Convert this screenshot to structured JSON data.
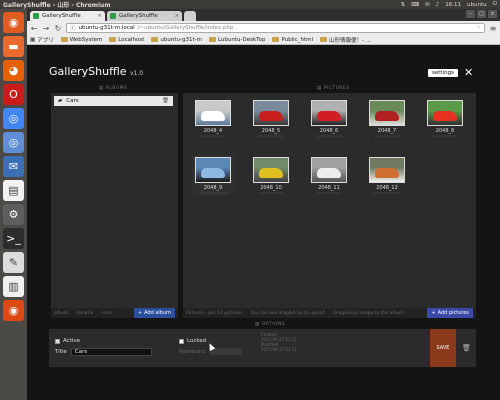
{
  "system": {
    "window_title": "GalleryShuffle - 山形 - Chromium",
    "clock": "16:11",
    "user": "ubuntu"
  },
  "launcher": [
    {
      "name": "dash-icon",
      "glyph": "◉",
      "color": "#e15b20"
    },
    {
      "name": "files-icon",
      "glyph": "▬",
      "color": "#e96a2c"
    },
    {
      "name": "firefox-icon",
      "glyph": "◕",
      "color": "#e66000"
    },
    {
      "name": "opera-icon",
      "glyph": "O",
      "color": "#cc1b1b"
    },
    {
      "name": "chrome-icon",
      "glyph": "◎",
      "color": "#4285f4"
    },
    {
      "name": "chromium-icon",
      "glyph": "◎",
      "color": "#5e8ed6"
    },
    {
      "name": "thunderbird-icon",
      "glyph": "✉",
      "color": "#3a6fb5"
    },
    {
      "name": "document-icon",
      "glyph": "▤",
      "color": "#f2f2f2"
    },
    {
      "name": "settings-app-icon",
      "glyph": "⚙",
      "color": "#5e5e5e"
    },
    {
      "name": "terminal-icon",
      "glyph": ">_",
      "color": "#2c2c2c"
    },
    {
      "name": "editor-icon",
      "glyph": "✎",
      "color": "#dcdcdc"
    },
    {
      "name": "text-icon",
      "glyph": "▥",
      "color": "#f0f0f0"
    },
    {
      "name": "ubuntu-icon",
      "glyph": "◉",
      "color": "#dd4814"
    }
  ],
  "tabs": [
    {
      "label": "GalleryShuffle",
      "active": true
    },
    {
      "label": "GalleryShuffle",
      "active": false
    }
  ],
  "toolbar": {
    "url_host": "ubuntu-g31t-m.local",
    "url_path": "/~ubuntu/GalleryShuffle/index.php"
  },
  "bookmarks": [
    "アプリ",
    "WebSystem",
    "Localhost",
    "ubuntu-g31t-m",
    "Lubuntu-DeskTop",
    "Public_html",
    "山形情報便！- ..."
  ],
  "app": {
    "title": "GalleryShuffle",
    "version": "v1.0",
    "settings_label": "settings",
    "close_label": "✕",
    "albums_label": "ALBUMS",
    "pictures_label": "PICTURES",
    "options_label": "OPTIONS"
  },
  "albums": {
    "items": [
      {
        "label": "Cars"
      }
    ],
    "footer": [
      "album",
      "rename",
      "rearr"
    ],
    "add_label": "Add album"
  },
  "pictures": {
    "items": [
      {
        "caption": "2048_4",
        "colors": [
          "#c9c9c9",
          "#ffffff",
          "#5a7a9a"
        ]
      },
      {
        "caption": "2048_5",
        "colors": [
          "#7a8a9a",
          "#c81e1e",
          "#3a3a3a"
        ]
      },
      {
        "caption": "2048_6",
        "colors": [
          "#b0b0b0",
          "#d41c24",
          "#222222"
        ]
      },
      {
        "caption": "2048_7",
        "colors": [
          "#6a8a5a",
          "#b02020",
          "#dddddd"
        ]
      },
      {
        "caption": "2048_8",
        "colors": [
          "#5a9a4a",
          "#e83020",
          "#333333"
        ]
      },
      {
        "caption": "2048_9",
        "colors": [
          "#5b87b5",
          "#8fb8e0",
          "#1a1a1a"
        ]
      },
      {
        "caption": "2048_10",
        "colors": [
          "#708a6a",
          "#e0c020",
          "#444444"
        ]
      },
      {
        "caption": "2048_11",
        "colors": [
          "#a0a0a0",
          "#eeeeee",
          "#555555"
        ]
      },
      {
        "caption": "2048_12",
        "colors": [
          "#707a60",
          "#d07030",
          "#f0f0f0"
        ]
      }
    ],
    "footer": [
      "Pictures - per 10 pictures",
      "You can use drag&drop to upload",
      "Drag&drop image to the album"
    ],
    "add_label": "Add pictures"
  },
  "options": {
    "active_label": "Active",
    "active_checked": true,
    "locked_label": "Locked",
    "locked_checked": false,
    "title_label": "Title",
    "title_value": "Cars",
    "password_label": "Password",
    "info_lines": [
      "Created",
      "2013-09-27 02:11",
      "Modified",
      "2013-09-27 02:11"
    ],
    "save_label": "SAVE"
  },
  "colors": {
    "accent": "#2a4f9e",
    "add_pictures_accent": "#3b4aa8",
    "save": "#8a3a1a"
  }
}
